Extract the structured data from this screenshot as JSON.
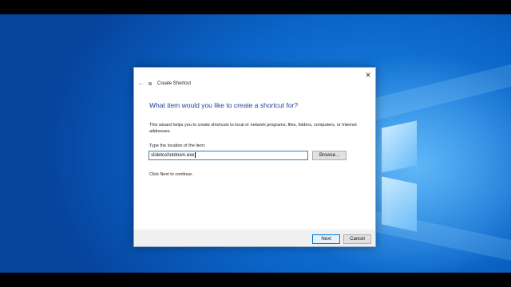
{
  "wallpaper": {
    "accent": "#0b66c9",
    "logo": "windows-logo"
  },
  "dialog": {
    "title": "Create Shortcut",
    "back_icon": "←",
    "close_icon": "✕",
    "heading": "What item would you like to create a shortcut for?",
    "description": "This wizard helps you to create shortcuts to local or network programs, files, folders, computers, or Internet addresses.",
    "location_label": "Type the location of the item:",
    "location_value": "slidetoshutdown.exe",
    "browse_label": "Browse...",
    "hint": "Click Next to continue.",
    "next_label": "Next",
    "cancel_label": "Cancel"
  }
}
